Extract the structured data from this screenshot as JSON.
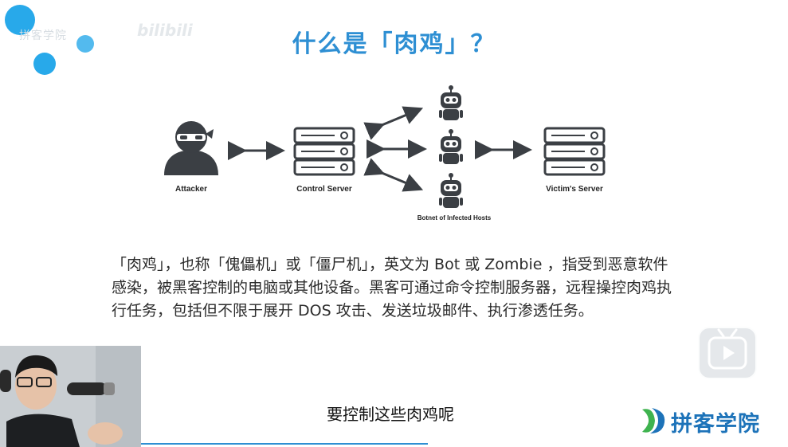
{
  "slide": {
    "title": "什么是「肉鸡」？",
    "watermark_text": "拼客学院",
    "watermark_site": "bilibili"
  },
  "diagram": {
    "attacker_label": "Attacker",
    "control_server_label": "Control Server",
    "botnet_label": "Botnet of Infected Hosts",
    "victim_label": "Victim's Server"
  },
  "body": {
    "line1": "「肉鸡」，也称「傀儡机」或「僵尸机」，英文为 Bot 或 Zombie ，指受到恶意软件",
    "line2": "感染，被黑客控制的电脑或其他设备。黑客可通过命令控制服务器，远程操控肉鸡执",
    "line3": "行任务，包括但不限于展开 DOS 攻击、发送垃圾邮件、执行渗透任务。"
  },
  "video": {
    "subtitle": "要控制这些肉鸡呢",
    "logo_text": "拼客学院"
  },
  "colors": {
    "accent": "#2e8fd3",
    "deco": "#28a9ea",
    "logo": "#1d73b9",
    "icon_dark": "#3b3f44"
  }
}
